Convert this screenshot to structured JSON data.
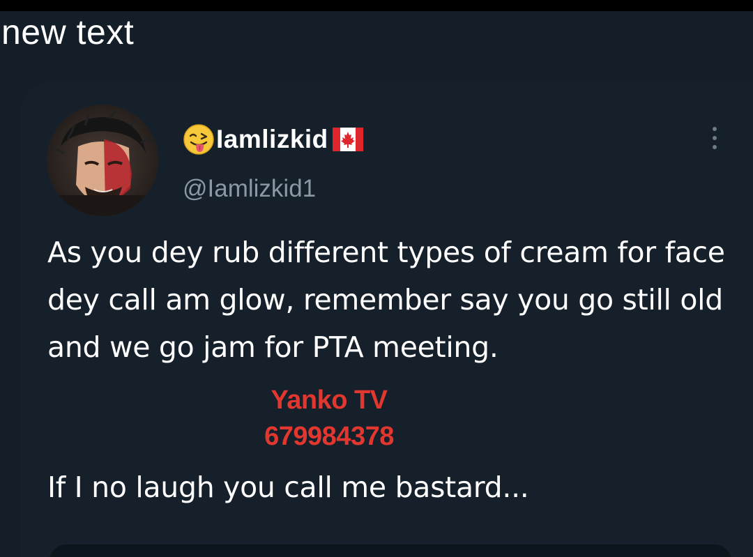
{
  "overlay": {
    "text": "new text"
  },
  "tweet": {
    "display_name": "Iamlizkid",
    "handle": "@Iamlizkid1",
    "body_paragraph_1": "As you dey rub different types of cream for face dey call am glow, remember say you go still old and we go jam for PTA meeting.",
    "body_paragraph_2": "If I no laugh you call me bastard...",
    "name_emoji_icon": "winking-tongue-emoji",
    "name_flag_icon": "canada-flag",
    "more_icon": "vertical-ellipsis"
  },
  "watermark": {
    "line1": "Yanko TV",
    "line2": "679984378"
  },
  "colors": {
    "background": "#15202b",
    "primary_text": "#ffffff",
    "secondary_text": "#8b98a5",
    "watermark": "#e2372f"
  }
}
